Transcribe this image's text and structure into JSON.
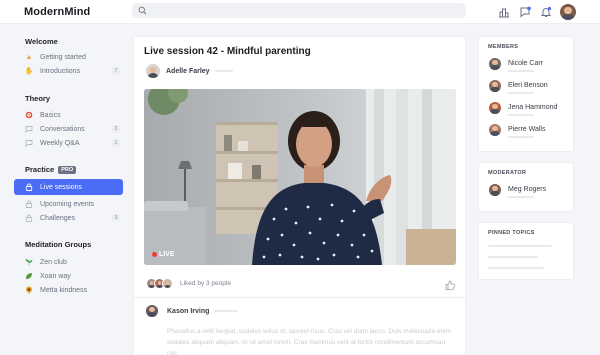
{
  "app": {
    "brand": "ModernMind"
  },
  "sidebar": {
    "groups": [
      {
        "title": "Welcome",
        "items": [
          {
            "label": "Getting started",
            "icon": "warning-icon",
            "icon_color": "#e8a32b"
          },
          {
            "label": "Introductions",
            "icon": "hand-icon",
            "icon_color": "#f2b234",
            "count": "7"
          }
        ]
      },
      {
        "title": "Theory",
        "items": [
          {
            "label": "Basics",
            "icon": "target-icon",
            "icon_color": "#e0533d"
          },
          {
            "label": "Conversations",
            "icon": "chat-bubble-icon",
            "icon_color": "#b5b9c4",
            "count": "3"
          },
          {
            "label": "Weekly Q&A",
            "icon": "chat-bubble-icon",
            "icon_color": "#b5b9c4",
            "count": "1"
          }
        ]
      },
      {
        "title": "Practice",
        "badge": "PRO",
        "items": [
          {
            "label": "Live sessions",
            "icon": "lock-icon",
            "active": true
          },
          {
            "label": "Upcoming events",
            "icon": "lock-icon"
          },
          {
            "label": "Challenges",
            "icon": "lock-icon",
            "count": "3"
          }
        ]
      },
      {
        "title": "Meditation Groups",
        "items": [
          {
            "label": "Zen club",
            "icon": "seedling-icon",
            "icon_color": "#4caf50"
          },
          {
            "label": "Xoan way",
            "icon": "leaf-icon",
            "icon_color": "#5b9e3c"
          },
          {
            "label": "Metta kindness",
            "icon": "sunflower-icon",
            "icon_color": "#e9a21f"
          }
        ]
      }
    ]
  },
  "session": {
    "title": "Live session 42 - Mindful parenting",
    "host": "Adelle Farley",
    "live_label": "LIVE",
    "liked_by": "Liked by 3 people"
  },
  "comment": {
    "author": "Kason Irving",
    "text": "Phasellus a velit feugiat, sodales tellus et, laoreet risus. Cras vel diam lacus. Duis malesuada enim sodales aliquam aliquam. In sit amet lorem. Cras maximus velit at tortor condimentum accumsan nisi."
  },
  "members": {
    "title": "MEMBERS",
    "list": [
      "Nicole Carr",
      "Eleri Benson",
      "Jena Hammond",
      "Pierre Walls"
    ]
  },
  "moderator": {
    "title": "MODERATOR",
    "name": "Meg Rogers"
  },
  "pinned": {
    "title": "PINNED TOPICS"
  },
  "colors": {
    "accent": "#4a6cf7",
    "live": "#f23a3a"
  }
}
